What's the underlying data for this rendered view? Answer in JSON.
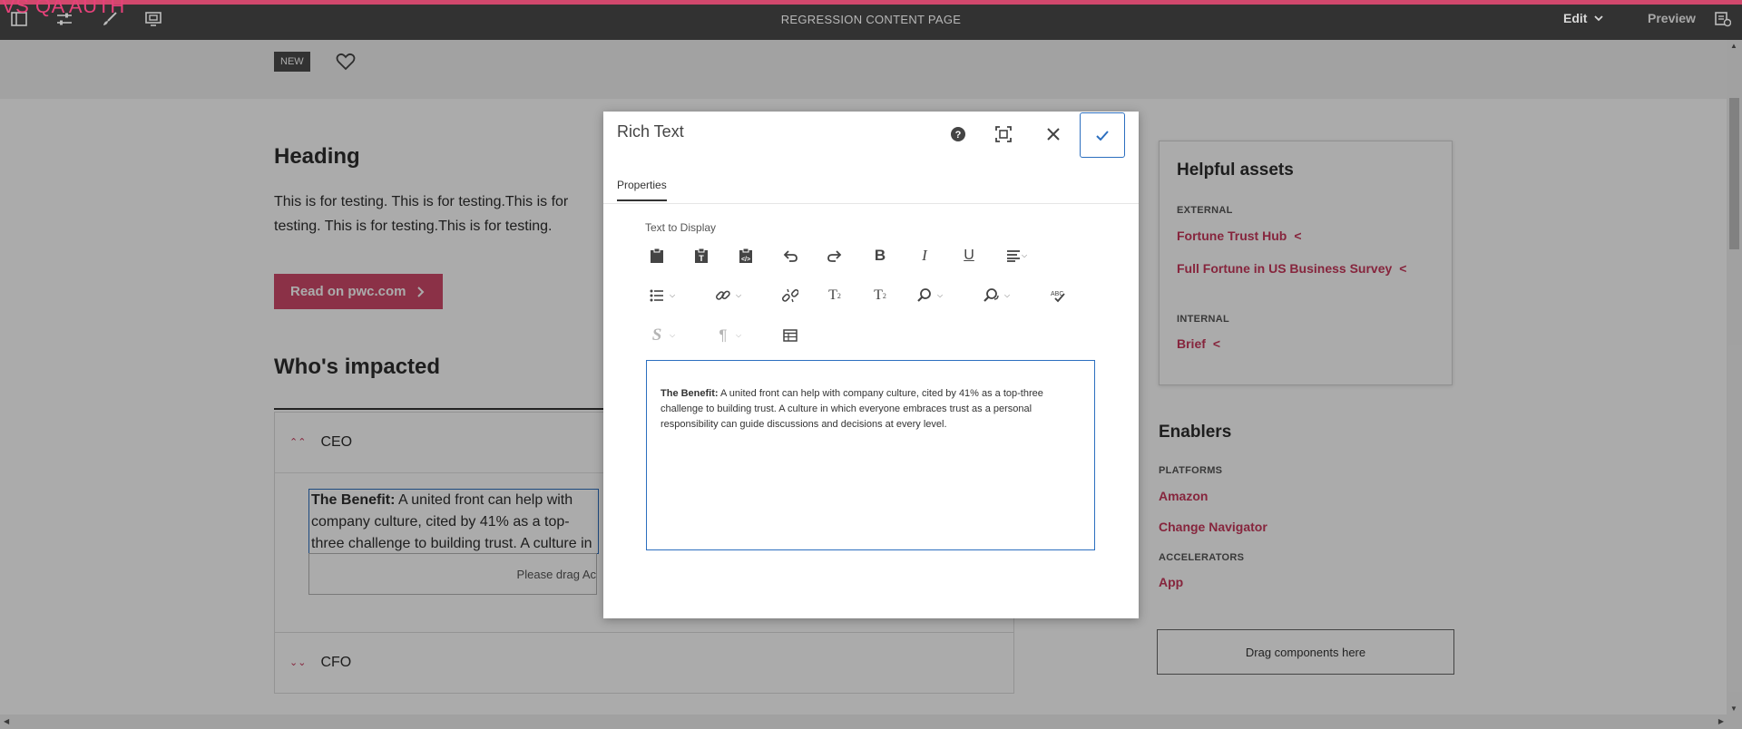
{
  "topbar": {
    "env_label": "VS QA AUTH",
    "page_title": "REGRESSION CONTENT PAGE",
    "mode": "Edit",
    "preview": "Preview",
    "icons": [
      "side-panel-icon",
      "page-properties-icon",
      "styles-brush-icon",
      "emulator-icon",
      "annotations-icon"
    ]
  },
  "page": {
    "badge": "NEW",
    "heading": "Heading",
    "body": "This is for testing. This is for testing.This is for testing. This is for testing.This is for testing.",
    "cta_label": "Read on pwc.com",
    "section_heading": "Who's impacted",
    "accordion": [
      {
        "title": "CEO",
        "expanded": true,
        "benefit_label": "The Benefit:",
        "benefit_text": " A united front can help with company culture, cited by 41% as a top-three challenge to building trust. A culture in which everyone embraces trust as a personal responsibility can guide discussions and decisions at every level.",
        "drag_placeholder": "Please drag Ac"
      },
      {
        "title": "CFO",
        "expanded": false
      }
    ]
  },
  "sidebar": {
    "assets_title": "Helpful assets",
    "external_label": "EXTERNAL",
    "external_links": [
      "Fortune Trust Hub",
      "Full Fortune in US Business Survey"
    ],
    "internal_label": "INTERNAL",
    "internal_links": [
      "Brief"
    ],
    "enablers_title": "Enablers",
    "platforms_label": "PLATFORMS",
    "platforms": [
      "Amazon",
      "Change Navigator"
    ],
    "accelerators_label": "ACCELERATORS",
    "accelerators": [
      "App"
    ],
    "drag_here": "Drag components here"
  },
  "dialog": {
    "title": "Rich Text",
    "tab": "Properties",
    "field_label": "Text to Display",
    "content_bold": "The Benefit:",
    "content_text": " A united front can help with company culture, cited by 41% as a top-three challenge to building trust. A culture in which everyone embraces trust as a personal responsibility can guide discussions and decisions at every level."
  },
  "colors": {
    "accent": "#d04a6b",
    "link": "#c8385b",
    "topbar": "#323232",
    "focus": "#2c6fbf"
  }
}
